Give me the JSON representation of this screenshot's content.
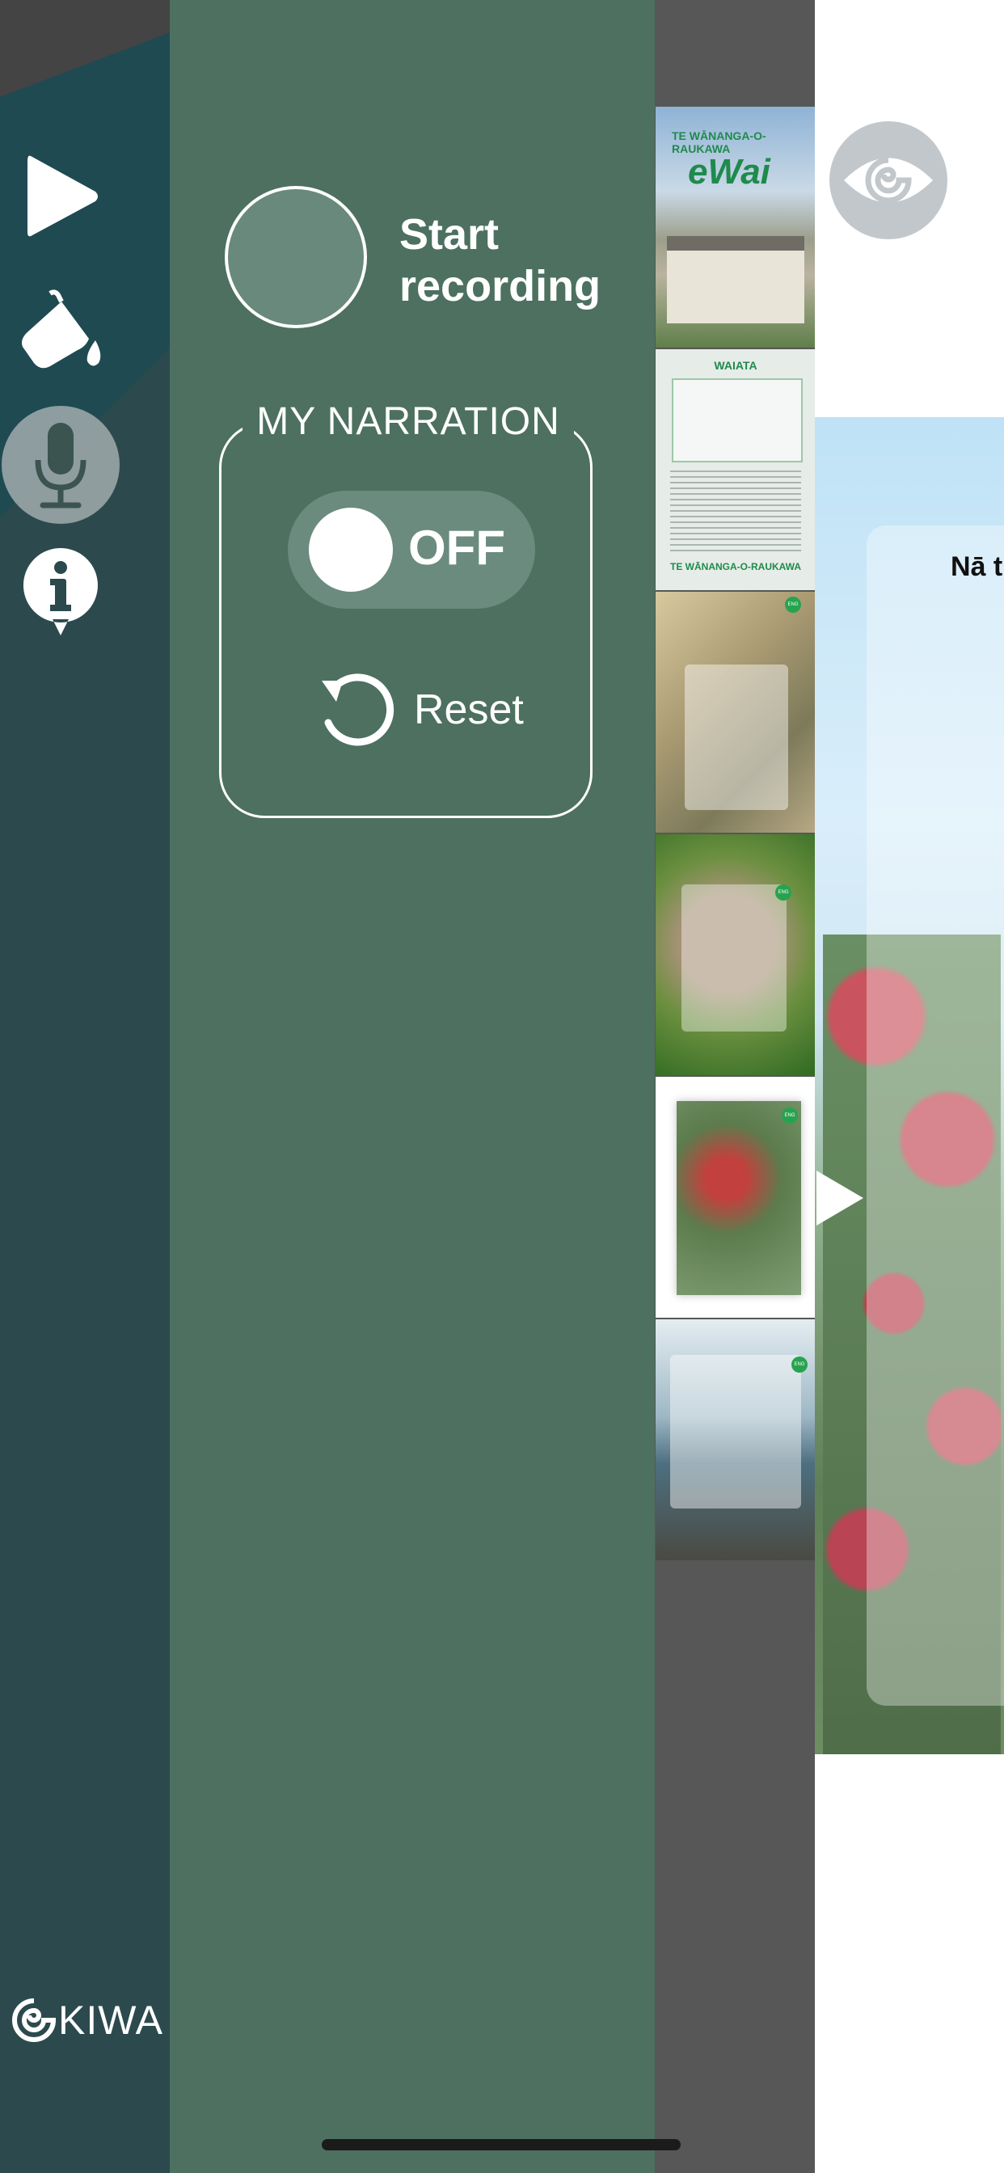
{
  "recorder": {
    "start_label": "Start recording"
  },
  "narration": {
    "title": "MY NARRATION",
    "toggle_state": "OFF",
    "reset_label": "Reset"
  },
  "brand": {
    "name": "KIWA"
  },
  "thumbnails": [
    {
      "title": "TE WĀNANGA-O-RAUKAWA",
      "subtitle": "eWai"
    },
    {
      "title": "WAIATA",
      "footer": "TE WĀNANGA-O-RAUKAWA"
    },
    {
      "badge": "ENG"
    },
    {
      "badge": "ENG"
    },
    {
      "badge": "ENG"
    },
    {
      "badge": "ENG"
    }
  ],
  "content": {
    "visible_text": "Nā t"
  },
  "colors": {
    "panel": "#4d7060",
    "rail": "#2c4a4d",
    "strip": "#575757"
  }
}
